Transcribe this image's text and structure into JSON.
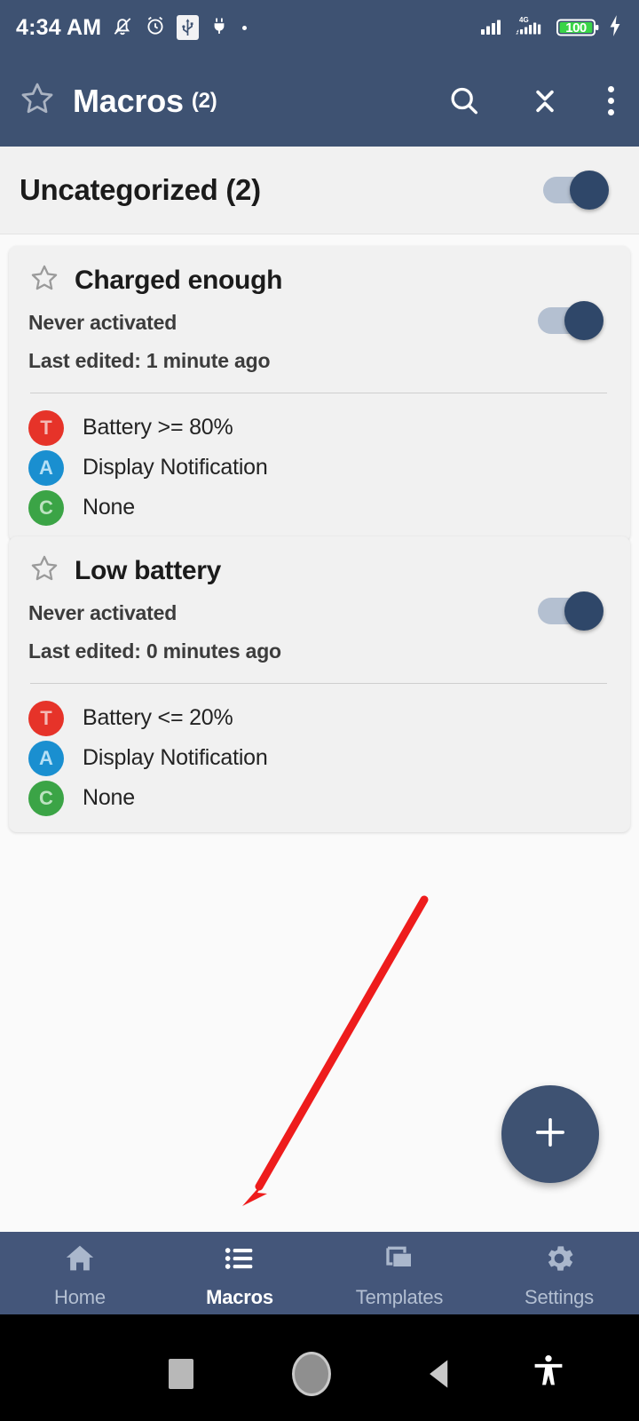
{
  "status_bar": {
    "time": "4:34 AM",
    "battery_level": "100",
    "network_type": "4G",
    "icons": [
      "bell-muted-icon",
      "alarm-icon",
      "usb-icon",
      "plug-icon",
      "dot-icon",
      "signal-icon",
      "signal-4g-icon",
      "battery-icon",
      "charging-bolt-icon"
    ]
  },
  "toolbar": {
    "star_icon": "star-outline-icon",
    "title": "Macros",
    "count": "(2)",
    "search_icon": "search-icon",
    "collapse_icon": "collapse-all-icon",
    "overflow_icon": "overflow-menu-icon"
  },
  "category": {
    "title": "Uncategorized (2)",
    "enabled": true
  },
  "macros": [
    {
      "title": "Charged enough",
      "status": "Never activated",
      "last_edited": "Last edited: 1 minute ago",
      "enabled": true,
      "favorite_icon": "star-outline-icon",
      "rows": [
        {
          "badge": "T",
          "badge_type": "trigger",
          "text": "Battery >= 80%"
        },
        {
          "badge": "A",
          "badge_type": "action",
          "text": "Display Notification"
        },
        {
          "badge": "C",
          "badge_type": "constraint",
          "text": "None"
        }
      ]
    },
    {
      "title": "Low battery",
      "status": "Never activated",
      "last_edited": "Last edited: 0 minutes ago",
      "enabled": true,
      "favorite_icon": "star-outline-icon",
      "rows": [
        {
          "badge": "T",
          "badge_type": "trigger",
          "text": "Battery <= 20%"
        },
        {
          "badge": "A",
          "badge_type": "action",
          "text": "Display Notification"
        },
        {
          "badge": "C",
          "badge_type": "constraint",
          "text": "None"
        }
      ]
    }
  ],
  "fab": {
    "icon": "plus-icon",
    "label": "+"
  },
  "annotation": {
    "type": "arrow",
    "color": "#ee1c1c",
    "points_to": "Macros tab"
  },
  "bottom_nav": {
    "items": [
      {
        "label": "Home",
        "icon": "home-icon",
        "active": false
      },
      {
        "label": "Macros",
        "icon": "list-icon",
        "active": true
      },
      {
        "label": "Templates",
        "icon": "templates-icon",
        "active": false
      },
      {
        "label": "Settings",
        "icon": "gear-icon",
        "active": false
      }
    ]
  },
  "system_nav": {
    "items": [
      {
        "name": "recents-button",
        "icon": "square-icon"
      },
      {
        "name": "home-button",
        "icon": "circle-icon"
      },
      {
        "name": "back-button",
        "icon": "triangle-left-icon"
      },
      {
        "name": "accessibility-button",
        "icon": "accessibility-icon"
      }
    ]
  },
  "colors": {
    "primary": "#3e5272",
    "nav": "#44567a",
    "card_bg": "#f1f1f1",
    "trigger": "#e63329",
    "action": "#1a8fd0",
    "constraint": "#3ba446",
    "battery_green": "#39d447",
    "annotation_red": "#ee1c1c"
  }
}
